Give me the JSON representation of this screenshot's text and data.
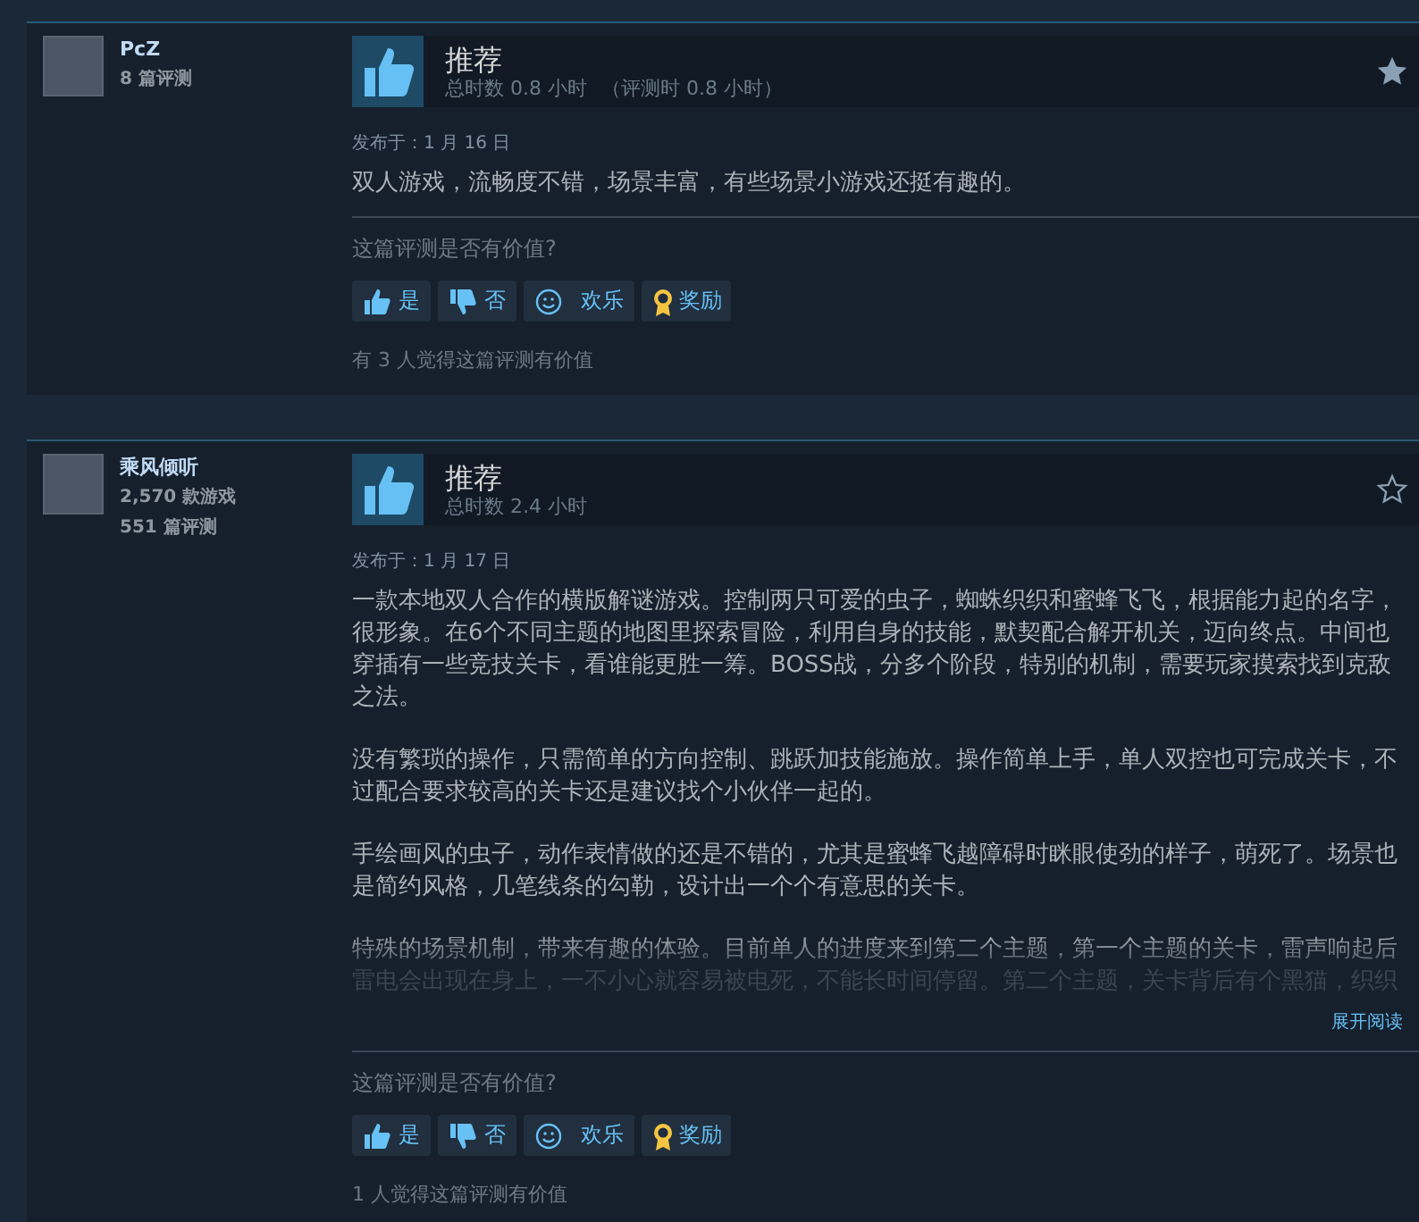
{
  "reviews": [
    {
      "author": {
        "name": "PcZ",
        "stats": [
          "8 篇评测"
        ]
      },
      "verdict": "推荐",
      "hours": "总时数 0.8 小时",
      "review_hours": "（评测时 0.8 小时）",
      "starred": true,
      "posted": "发布于：1 月 16 日",
      "truncated": false,
      "paragraphs": [
        "双人游戏，流畅度不错，场景丰富，有些场景小游戏还挺有趣的。"
      ],
      "helpful_prompt": "这篇评测是否有价值?",
      "votes": [
        {
          "kind": "yes",
          "label": "是"
        },
        {
          "kind": "no",
          "label": "否"
        },
        {
          "kind": "funny",
          "label": "欢乐"
        },
        {
          "kind": "award",
          "label": "奖励"
        }
      ],
      "helpful_count": "有 3 人觉得这篇评测有价值"
    },
    {
      "author": {
        "name": "乘风倾听",
        "stats": [
          "2,570 款游戏",
          "551 篇评测"
        ]
      },
      "verdict": "推荐",
      "hours": "总时数 2.4 小时",
      "starred": false,
      "posted": "发布于：1 月 17 日",
      "truncated": true,
      "paragraphs": [
        "一款本地双人合作的横版解谜游戏。控制两只可爱的虫子，蜘蛛织织和蜜蜂飞飞，根据能力起的名字，很形象。在6个不同主题的地图里探索冒险，利用自身的技能，默契配合解开机关，迈向终点。中间也穿插有一些竞技关卡，看谁能更胜一筹。BOSS战，分多个阶段，特别的机制，需要玩家摸索找到克敌之法。",
        "没有繁琐的操作，只需简单的方向控制、跳跃加技能施放。操作简单上手，单人双控也可完成关卡，不过配合要求较高的关卡还是建议找个小伙伴一起的。",
        "手绘画风的虫子，动作表情做的还是不错的，尤其是蜜蜂飞越障碍时眯眼使劲的样子，萌死了。场景也是简约风格，几笔线条的勾勒，设计出一个个有意思的关卡。",
        "特殊的场景机制，带来有趣的体验。目前单人的进度来到第二个主题，第一个主题的关卡，雷声响起后雷电会出现在身上，一不小心就容易被电死，不能长时间停留。第二个主题，关卡背后有个黑猫，织织"
      ],
      "expand_link": "展开阅读",
      "helpful_prompt": "这篇评测是否有价值?",
      "votes": [
        {
          "kind": "yes",
          "label": "是"
        },
        {
          "kind": "no",
          "label": "否"
        },
        {
          "kind": "funny",
          "label": "欢乐"
        },
        {
          "kind": "award",
          "label": "奖励"
        }
      ],
      "helpful_count": "1 人觉得这篇评测有价值"
    }
  ]
}
